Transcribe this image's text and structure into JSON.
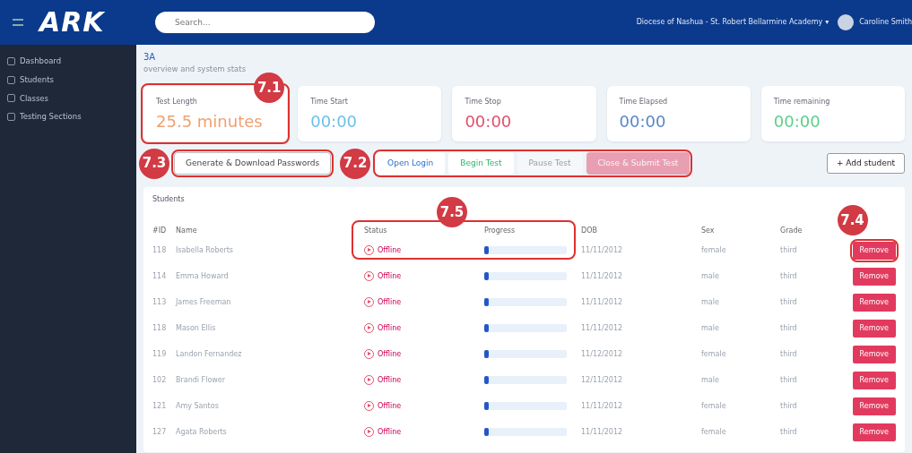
{
  "header": {
    "logo": "ARK",
    "search": {
      "placeholder": "Search..."
    },
    "organization": "Diocese of Nashua - St. Robert Bellarmine Academy",
    "organization_caret": "▾",
    "user": "Caroline Smith"
  },
  "sidebar": {
    "items": [
      {
        "label": "Dashboard",
        "selected": false
      },
      {
        "label": "Students",
        "selected": false
      },
      {
        "label": "Classes",
        "selected": false
      },
      {
        "label": "Testing Sections",
        "selected": false
      }
    ]
  },
  "page": {
    "title": "3A",
    "subtitle": "overview and system stats"
  },
  "stats": [
    {
      "label": "Test Length",
      "value": "25.5 minutes",
      "color": "#f0a070"
    },
    {
      "label": "Time Start",
      "value": "00:00",
      "color": "#6cc0e8"
    },
    {
      "label": "Time Stop",
      "value": "00:00",
      "color": "#e0506a"
    },
    {
      "label": "Time Elapsed",
      "value": "00:00",
      "color": "#5a86c8"
    },
    {
      "label": "Time remaining",
      "value": "00:00",
      "color": "#5ccf8a"
    }
  ],
  "actions": [
    {
      "label": "Generate & Download Passwords",
      "kind": "outline",
      "disabled": false
    },
    {
      "label": "Open Login",
      "kind": "link",
      "disabled": false
    },
    {
      "label": "Begin Test",
      "kind": "success",
      "disabled": false
    },
    {
      "label": "Pause Test",
      "kind": "plain",
      "disabled": true
    },
    {
      "label": "Close & Submit Test",
      "kind": "danger",
      "disabled": true
    }
  ],
  "add_button": "+ Add student",
  "students": {
    "title": "Students",
    "columns": [
      "#ID",
      "Name",
      "Status",
      "Progress",
      "DOB",
      "Sex",
      "Grade"
    ],
    "rows": [
      {
        "id": "118",
        "name": "Isabella Roberts",
        "status": "Offline",
        "level": 0.05,
        "dob": "11/11/2012",
        "sex": "female",
        "grade": "third",
        "action": "Remove"
      },
      {
        "id": "114",
        "name": "Emma Howard",
        "status": "Offline",
        "level": 0.05,
        "dob": "11/11/2012",
        "sex": "male",
        "grade": "third",
        "action": "Remove"
      },
      {
        "id": "113",
        "name": "James Freeman",
        "status": "Offline",
        "level": 0.05,
        "dob": "11/11/2012",
        "sex": "male",
        "grade": "third",
        "action": "Remove"
      },
      {
        "id": "118",
        "name": "Mason Ellis",
        "status": "Offline",
        "level": 0.05,
        "dob": "11/11/2012",
        "sex": "male",
        "grade": "third",
        "action": "Remove"
      },
      {
        "id": "119",
        "name": "Landon Fernandez",
        "status": "Offline",
        "level": 0.05,
        "dob": "11/12/2012",
        "sex": "female",
        "grade": "third",
        "action": "Remove"
      },
      {
        "id": "102",
        "name": "Brandi Flower",
        "status": "Offline",
        "level": 0.05,
        "dob": "12/11/2012",
        "sex": "male",
        "grade": "third",
        "action": "Remove"
      },
      {
        "id": "121",
        "name": "Amy Santos",
        "status": "Offline",
        "level": 0.05,
        "dob": "11/11/2012",
        "sex": "female",
        "grade": "third",
        "action": "Remove"
      },
      {
        "id": "127",
        "name": "Agata Roberts",
        "status": "Offline",
        "level": 0.05,
        "dob": "11/11/2012",
        "sex": "female",
        "grade": "third",
        "action": "Remove"
      }
    ]
  },
  "annotations": [
    {
      "label": "7.1",
      "kind": "stat"
    },
    {
      "label": "7.3",
      "kind": "passwords"
    },
    {
      "label": "7.2",
      "kind": "controls"
    },
    {
      "label": "7.5",
      "kind": "progress"
    },
    {
      "label": "7.4",
      "kind": "remove"
    }
  ]
}
